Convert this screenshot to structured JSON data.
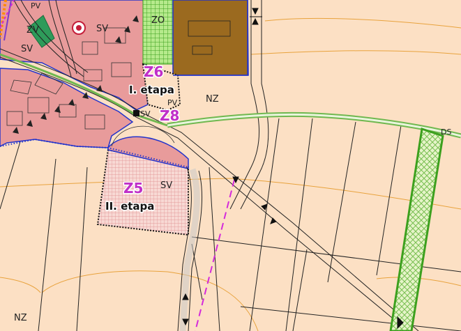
{
  "map": {
    "colors": {
      "background": "#fce0c4",
      "urban": "#e89b9b",
      "brown_area": "#9b6a1f",
      "green_hatch": "#7ad04a",
      "zv_green": "#2e9b5a",
      "magenta": "#d42adb",
      "blue_boundary": "#2233cc",
      "contour": "#e8a23c"
    },
    "labels": {
      "pv_top": "PV",
      "sv_top": "SV",
      "zv": "ZV",
      "sv_left": "SV",
      "zo": "ZO",
      "z6_code": "Z6",
      "z6_etapa": "I. etapa",
      "nz_center": "NZ",
      "pv_mid": "PV",
      "z8_code": "Z8",
      "sv_mid": "SV",
      "ds": "DS",
      "z5_code": "Z5",
      "sv_z5": "SV",
      "z5_etapa": "II. etapa",
      "nz_bottom": "NZ"
    },
    "icons": {
      "heritage_symbol": "circle-dot-icon",
      "junction_marker": "square-marker-icon"
    }
  }
}
